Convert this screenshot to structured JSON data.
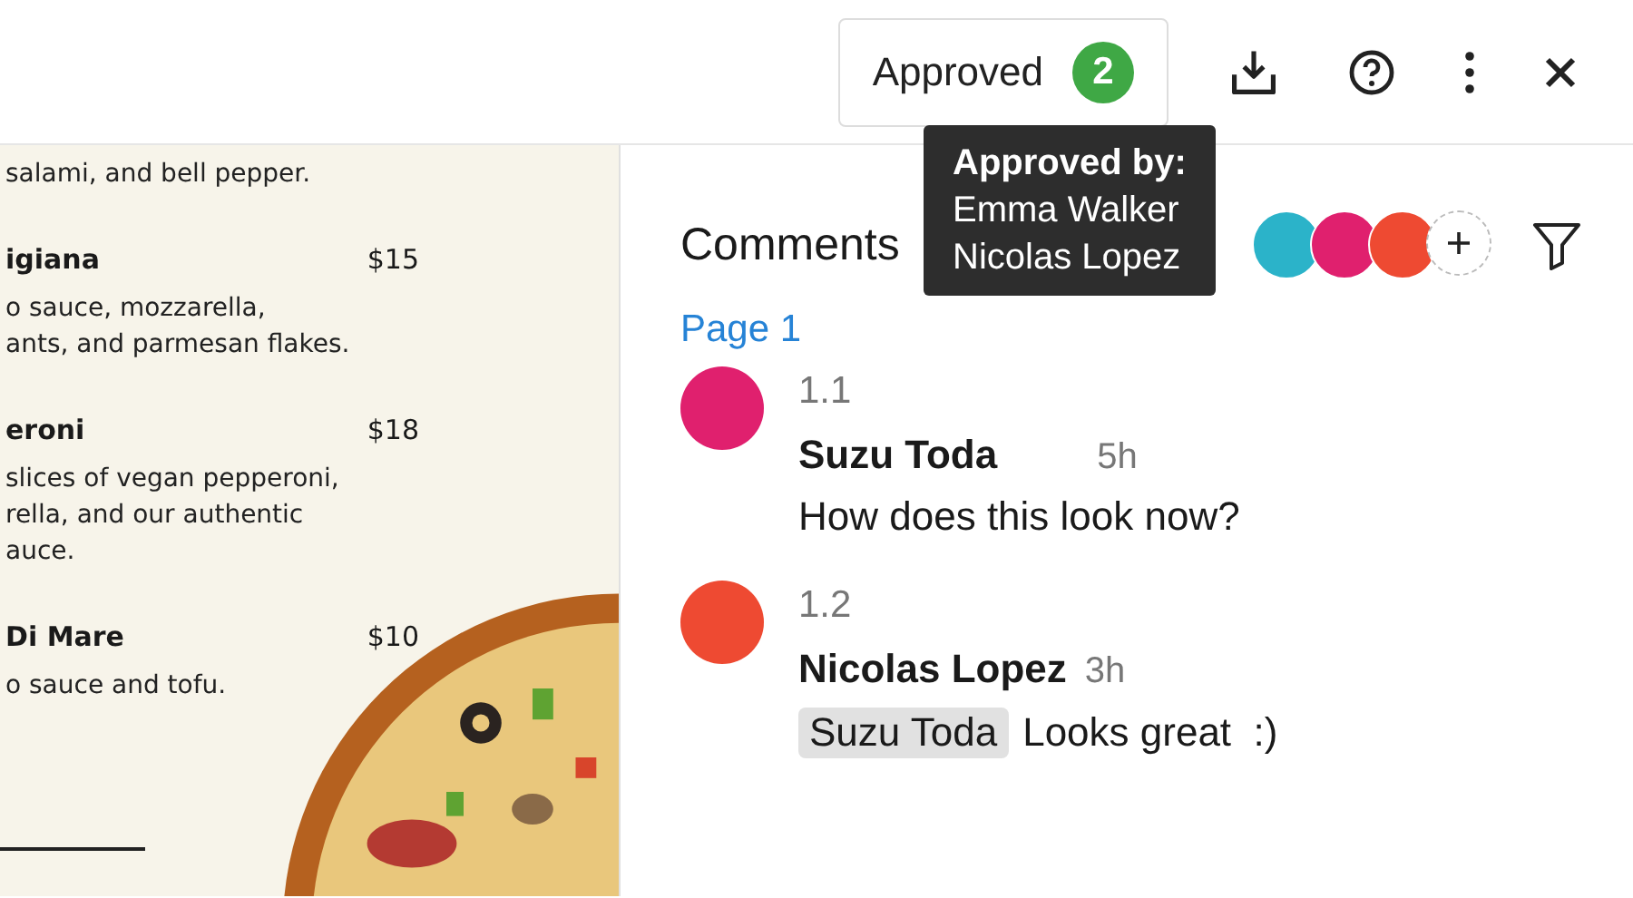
{
  "toolbar": {
    "approved_button": {
      "label": "Approved",
      "count": "2"
    },
    "tooltip": {
      "title": "Approved by:",
      "names": [
        "Emma Walker",
        "Nicolas Lopez"
      ]
    }
  },
  "menu": {
    "intro": "salami, and bell pepper.",
    "items": [
      {
        "name": "igiana",
        "price": "$15",
        "description": [
          "o sauce, mozzarella,",
          "ants, and parmesan flakes."
        ]
      },
      {
        "name": "eroni",
        "price": "$18",
        "description": [
          "slices of vegan pepperoni,",
          "rella, and our authentic",
          "auce."
        ]
      },
      {
        "name": "Di Mare",
        "price": "$10",
        "description": [
          "o sauce and tofu."
        ]
      }
    ]
  },
  "comments": {
    "title": "Comments",
    "participants": [
      {
        "color": "#2bb3c9"
      },
      {
        "color": "#e0206e"
      },
      {
        "color": "#ee4a32"
      }
    ],
    "page_label": "Page 1",
    "items": [
      {
        "number": "1.1",
        "author": "Suzu Toda",
        "time": "5h",
        "color": "#e0206e",
        "text": "How does this look now?"
      },
      {
        "number": "1.2",
        "author": "Nicolas Lopez",
        "time": "3h",
        "color": "#ee4a32",
        "mention": "Suzu Toda",
        "text": "Looks great  :)"
      }
    ]
  }
}
